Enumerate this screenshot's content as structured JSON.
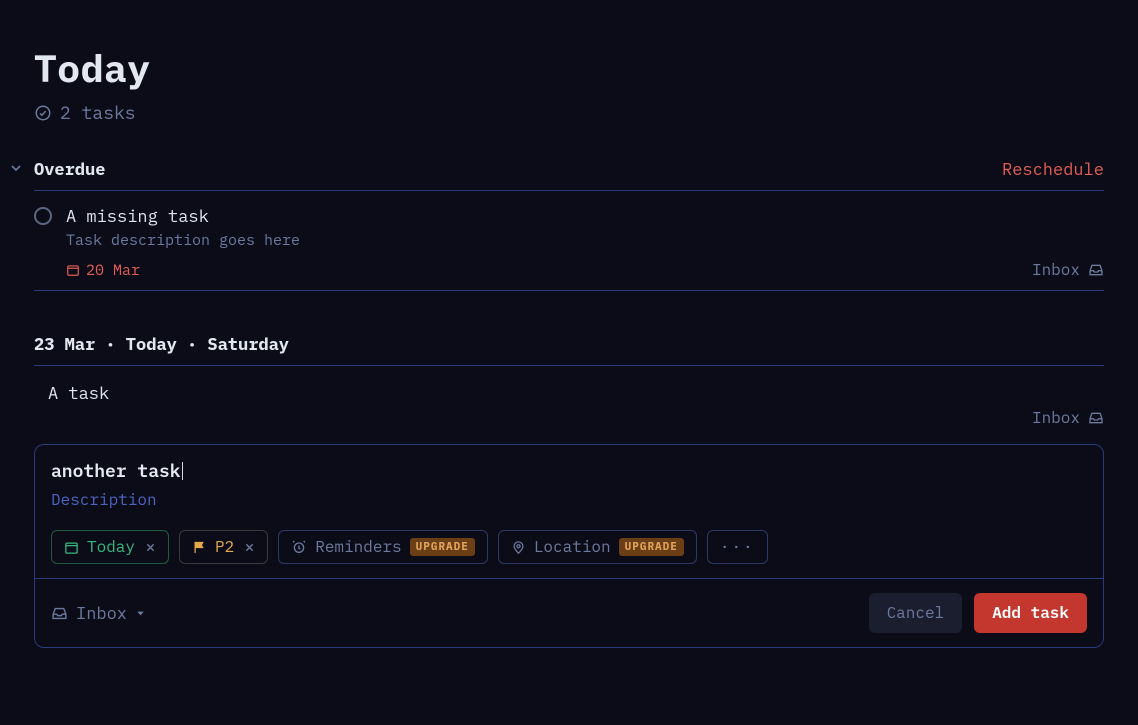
{
  "header": {
    "title": "Today",
    "task_count": "2 tasks"
  },
  "overdue": {
    "label": "Overdue",
    "reschedule_label": "Reschedule",
    "task": {
      "title": "A missing task",
      "description": "Task description goes here",
      "due": "20 Mar",
      "project": "Inbox"
    }
  },
  "today_section": {
    "label": "23 Mar · Today · Saturday",
    "task": {
      "title": "A task",
      "project": "Inbox"
    }
  },
  "editor": {
    "name_value": "another task",
    "description_placeholder": "Description",
    "chips": {
      "today": "Today",
      "priority": "P2",
      "reminders": "Reminders",
      "location": "Location",
      "upgrade_badge": "UPGRADE",
      "more": "···"
    },
    "project": "Inbox",
    "cancel_label": "Cancel",
    "add_label": "Add task"
  },
  "icons": {
    "check_circle": "check-circle",
    "chevron_down": "chevron-down",
    "calendar": "calendar",
    "inbox": "inbox-tray",
    "flag": "flag",
    "alarm": "alarm",
    "pin": "location-pin",
    "caret_down": "caret-down",
    "close": "close"
  }
}
